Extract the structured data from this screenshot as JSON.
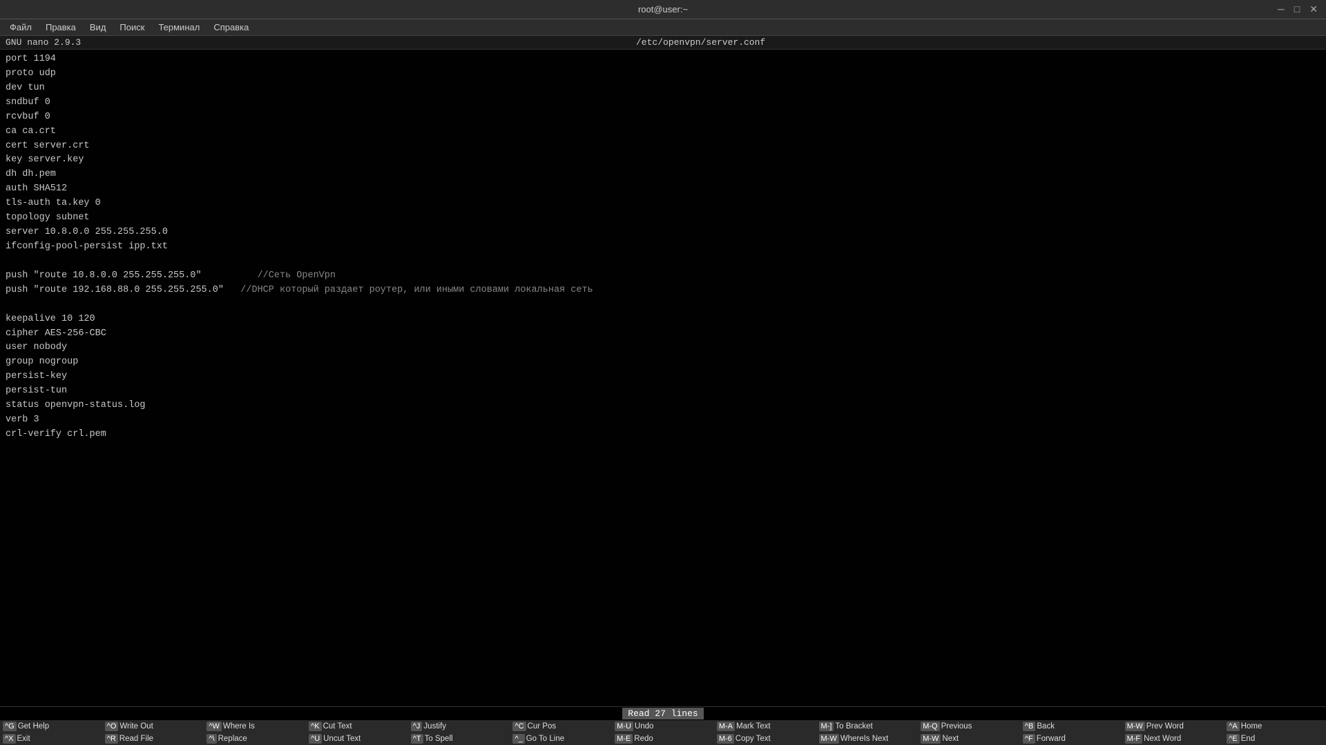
{
  "window": {
    "title": "root@user:~",
    "minimize_btn": "─",
    "maximize_btn": "□",
    "close_btn": "✕"
  },
  "menubar": {
    "items": [
      "Файл",
      "Правка",
      "Вид",
      "Поиск",
      "Терминал",
      "Справка"
    ]
  },
  "nano_header": {
    "left": "GNU nano 2.9.3",
    "center": "/etc/openvpn/server.conf"
  },
  "editor": {
    "lines": [
      {
        "text": "port 1194",
        "comment": false
      },
      {
        "text": "proto udp",
        "comment": false
      },
      {
        "text": "dev tun",
        "comment": false
      },
      {
        "text": "sndbuf 0",
        "comment": false
      },
      {
        "text": "rcvbuf 0",
        "comment": false
      },
      {
        "text": "ca ca.crt",
        "comment": false
      },
      {
        "text": "cert server.crt",
        "comment": false
      },
      {
        "text": "key server.key",
        "comment": false
      },
      {
        "text": "dh dh.pem",
        "comment": false
      },
      {
        "text": "auth SHA512",
        "comment": false
      },
      {
        "text": "tls-auth ta.key 0",
        "comment": false
      },
      {
        "text": "topology subnet",
        "comment": false
      },
      {
        "text": "server 10.8.0.0 255.255.255.0",
        "comment": false
      },
      {
        "text": "ifconfig-pool-persist ipp.txt",
        "comment": false
      },
      {
        "text": "",
        "comment": false
      },
      {
        "text": "push \"route 10.8.0.0 255.255.255.0\"          //Сеть OpenVpn",
        "comment": false
      },
      {
        "text": "push \"route 192.168.88.0 255.255.255.0\"   //DHCP который раздает роутер, или иными словами локальная сеть",
        "comment": false
      },
      {
        "text": "",
        "comment": false
      },
      {
        "text": "keepalive 10 120",
        "comment": false
      },
      {
        "text": "cipher AES-256-CBC",
        "comment": false
      },
      {
        "text": "user nobody",
        "comment": false
      },
      {
        "text": "group nogroup",
        "comment": false
      },
      {
        "text": "persist-key",
        "comment": false
      },
      {
        "text": "persist-tun",
        "comment": false
      },
      {
        "text": "status openvpn-status.log",
        "comment": false
      },
      {
        "text": "verb 3",
        "comment": false
      },
      {
        "text": "crl-verify crl.pem",
        "comment": false
      }
    ]
  },
  "status": {
    "message": "Read 27 lines"
  },
  "shortcuts": {
    "row1": [
      {
        "key": "^G",
        "label": "Get Help"
      },
      {
        "key": "^O",
        "label": "Write Out"
      },
      {
        "key": "^W",
        "label": "Where Is"
      },
      {
        "key": "^K",
        "label": "Cut Text"
      },
      {
        "key": "^J",
        "label": "Justify"
      },
      {
        "key": "^C",
        "label": "Cur Pos"
      },
      {
        "key": "M-U",
        "label": "Undo"
      },
      {
        "key": "M-A",
        "label": "Mark Text"
      },
      {
        "key": "M-]",
        "label": "To Bracket"
      },
      {
        "key": "M-Q",
        "label": "Previous"
      },
      {
        "key": "^B",
        "label": "Back"
      },
      {
        "key": "M-W",
        "label": "Prev Word"
      },
      {
        "key": "^A",
        "label": "Home"
      }
    ],
    "row2": [
      {
        "key": "^X",
        "label": "Exit"
      },
      {
        "key": "^R",
        "label": "Read File"
      },
      {
        "key": "^\\",
        "label": "Replace"
      },
      {
        "key": "^U",
        "label": "Uncut Text"
      },
      {
        "key": "^T",
        "label": "To Spell"
      },
      {
        "key": "^_",
        "label": "Go To Line"
      },
      {
        "key": "M-E",
        "label": "Redo"
      },
      {
        "key": "M-6",
        "label": "Copy Text"
      },
      {
        "key": "M-W",
        "label": "WhereIs Next"
      },
      {
        "key": "M-W",
        "label": "Next"
      },
      {
        "key": "^F",
        "label": "Forward"
      },
      {
        "key": "M-F",
        "label": "Next Word"
      },
      {
        "key": "^E",
        "label": "End"
      }
    ]
  }
}
